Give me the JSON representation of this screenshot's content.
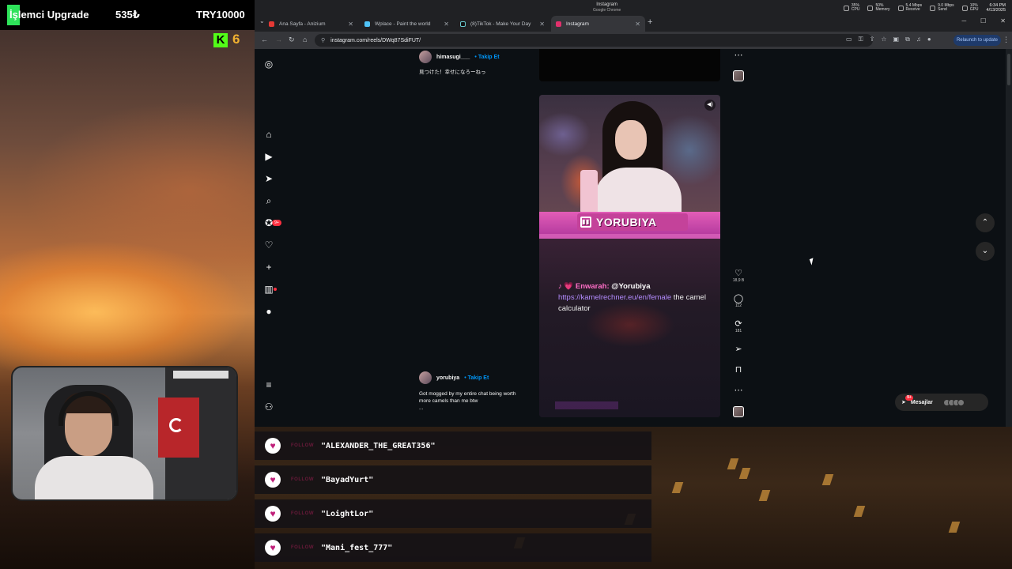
{
  "overlay": {
    "upgrade_label": "İşlemci Upgrade",
    "upgrade_count": "535₺",
    "goal": "TRY10000",
    "kick_letter": "K",
    "kick_count": "6"
  },
  "tray": {
    "title": "Instagram",
    "subtitle": "Google Chrome",
    "stats": [
      {
        "value": "35%",
        "label": "CPU"
      },
      {
        "value": "50%",
        "label": "Memory"
      },
      {
        "value": "5.4 Mbps",
        "label": "Receive"
      },
      {
        "value": "9.0 Mbps",
        "label": "Send"
      },
      {
        "value": "10%",
        "label": "GPU"
      }
    ],
    "time": "6:34 PM",
    "date": "4/13/2025"
  },
  "tabs": [
    {
      "label": "Ana Sayfa - Anizium",
      "color": "#e53935"
    },
    {
      "label": "Wplace - Paint the world",
      "color": "#4fc3f7"
    },
    {
      "label": "(8)TikTok - Make Your Day",
      "color": "#111111"
    },
    {
      "label": "Instagram",
      "color": "#e1306c"
    }
  ],
  "toolbar": {
    "url": "instagram.com/reels/DWq87SdiFUT/",
    "relaunch": "Relaunch to update"
  },
  "ig": {
    "badge": "9+",
    "post1": {
      "user": "himasugi___",
      "follow": "• Takip Et",
      "caption": "見つけた！幸せになろーねっ"
    },
    "post2": {
      "user": "yorubiya",
      "follow": "• Takip Et",
      "caption_line1": "Got mogged by my entire chat being worth",
      "caption_line2": "more camels than me btw",
      "more": "..."
    },
    "reel": {
      "streamer": "YORUBIYA",
      "chat_prefix": "♪ 💗",
      "chat_name": "Enwarah:",
      "chat_mention": "@Yorubiya",
      "chat_link": "https://kamelrechner.eu/en/female",
      "chat_text": "the camel calculator"
    },
    "counts": {
      "likes": "18,9 B",
      "comments": "112",
      "reposts": "181"
    },
    "messages": "Mesajlar",
    "messages_badge": "9+"
  },
  "alerts": [
    {
      "tag": "FOLLOW",
      "name": "\"ALEXANDER_THE_GREAT356\""
    },
    {
      "tag": "FOLLOW",
      "name": "\"BayadYurt\""
    },
    {
      "tag": "FOLLOW",
      "name": "\"LoightLor\""
    },
    {
      "tag": "FOLLOW",
      "name": "\"Mani_fest_777\""
    }
  ]
}
